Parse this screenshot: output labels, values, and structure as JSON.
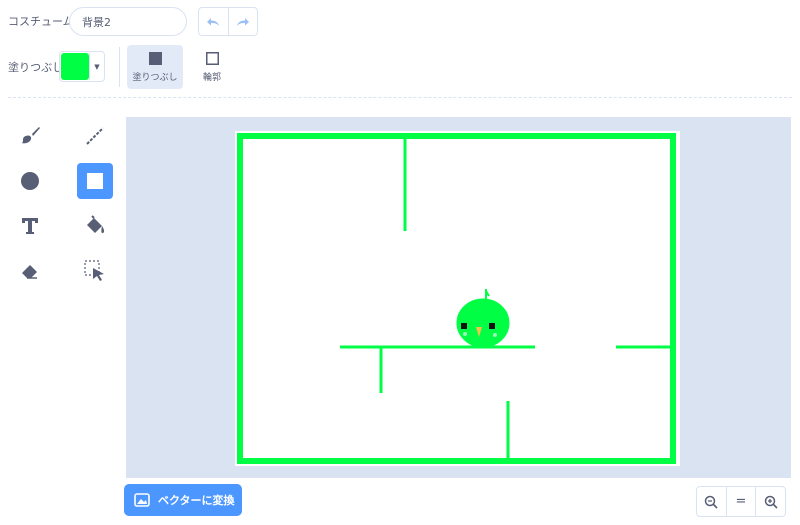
{
  "header": {
    "costume_label": "コスチューム",
    "costume_name": "背景2"
  },
  "fill": {
    "label": "塗りつぶし",
    "color": "#00ff44",
    "fill_mode_label": "塗りつぶし",
    "outline_mode_label": "輪郭"
  },
  "tools": {
    "selected": "rectangle-tool",
    "icons": [
      "brush-icon",
      "line-icon",
      "circle-icon",
      "rectangle-icon",
      "text-icon",
      "fill-bucket-icon",
      "eraser-icon",
      "select-icon"
    ]
  },
  "footer": {
    "convert_label": "ベクターに変換",
    "zoom_equal": "="
  },
  "colors": {
    "accent": "#4c97ff",
    "canvas_bg": "#d9e3f2",
    "maze_green": "#00ff44"
  }
}
